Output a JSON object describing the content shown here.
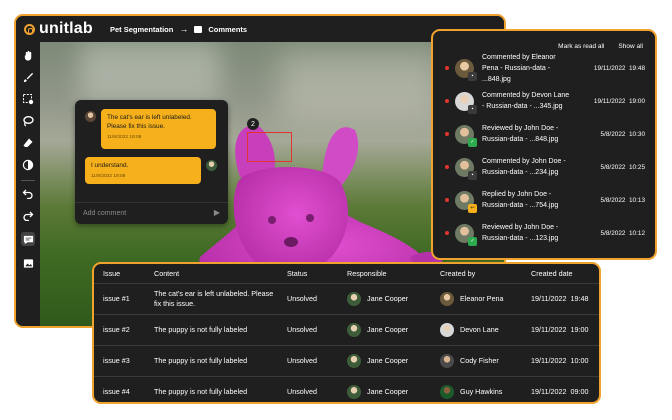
{
  "app": {
    "logo": "unitlab",
    "breadcrumb": {
      "project": "Pet Segmentation",
      "separator": "→",
      "page": "Comments"
    },
    "tools": [
      "hand-icon",
      "brush-icon",
      "magic-select-icon",
      "lasso-icon",
      "eraser-icon",
      "contrast-icon",
      "undo-icon",
      "redo-icon",
      "comment-icon",
      "image-icon"
    ]
  },
  "comment_thread": {
    "marker_number": "2",
    "messages": [
      {
        "text": "The cat's ear is left unlabeled. Please fix this issue.",
        "time": "11/9/2022 19:08"
      },
      {
        "text": "I understand.",
        "time": "11/9/2022 19:08"
      }
    ],
    "input_placeholder": "Add comment",
    "send_glyph": "▶"
  },
  "notifications": {
    "mark_all": "Mark as read all",
    "show_all": "Show all",
    "items": [
      {
        "text": "Commented by Eleanor Pena - Russian-data - ...848.jpg",
        "date": "19/11/2022",
        "time": "19:48"
      },
      {
        "text": "Commented by Devon Lane - Russian-data - ...345.jpg",
        "date": "19/11/2022",
        "time": "19:00"
      },
      {
        "text": "Reviewed by John Doe - Russian-data - ...848.jpg",
        "date": "5/8/2022",
        "time": "10:30"
      },
      {
        "text": "Commented by John Doe - Russian-data - ...234.jpg",
        "date": "5/8/2022",
        "time": "10:25"
      },
      {
        "text": "Replied by John Doe - Russian-data - ...754.jpg",
        "date": "5/8/2022",
        "time": "10:13"
      },
      {
        "text": "Reviewed by John Doe - Russian-data - ...123.jpg",
        "date": "5/8/2022",
        "time": "10:12"
      }
    ]
  },
  "issues_table": {
    "headers": [
      "Issue",
      "Content",
      "Status",
      "Responsible",
      "Created by",
      "Created date"
    ],
    "rows": [
      {
        "issue": "issue #1",
        "content": "The cat's ear is left unlabeled. Please fix this issue.",
        "status": "Unsolved",
        "responsible": "Jane Cooper",
        "created_by": "Eleanor Pena",
        "date": "19/11/2022",
        "time": "19:48"
      },
      {
        "issue": "issue #2",
        "content": "The puppy is not fully labeled",
        "status": "Unsolved",
        "responsible": "Jane Cooper",
        "created_by": "Devon Lane",
        "date": "19/11/2022",
        "time": "19:00"
      },
      {
        "issue": "issue #3",
        "content": "The puppy is not fully labeled",
        "status": "Unsolved",
        "responsible": "Jane Cooper",
        "created_by": "Cody Fisher",
        "date": "19/11/2022",
        "time": "10:00"
      },
      {
        "issue": "issue #4",
        "content": "The puppy is not fully labeled",
        "status": "Unsolved",
        "responsible": "Jane Cooper",
        "created_by": "Guy Hawkins",
        "date": "19/11/2022",
        "time": "09:00"
      }
    ]
  },
  "colors": {
    "accent": "#f0a22e",
    "mask": "#d63fc8",
    "unread_dot": "#e0362f",
    "panel": "#1f1f1f"
  }
}
